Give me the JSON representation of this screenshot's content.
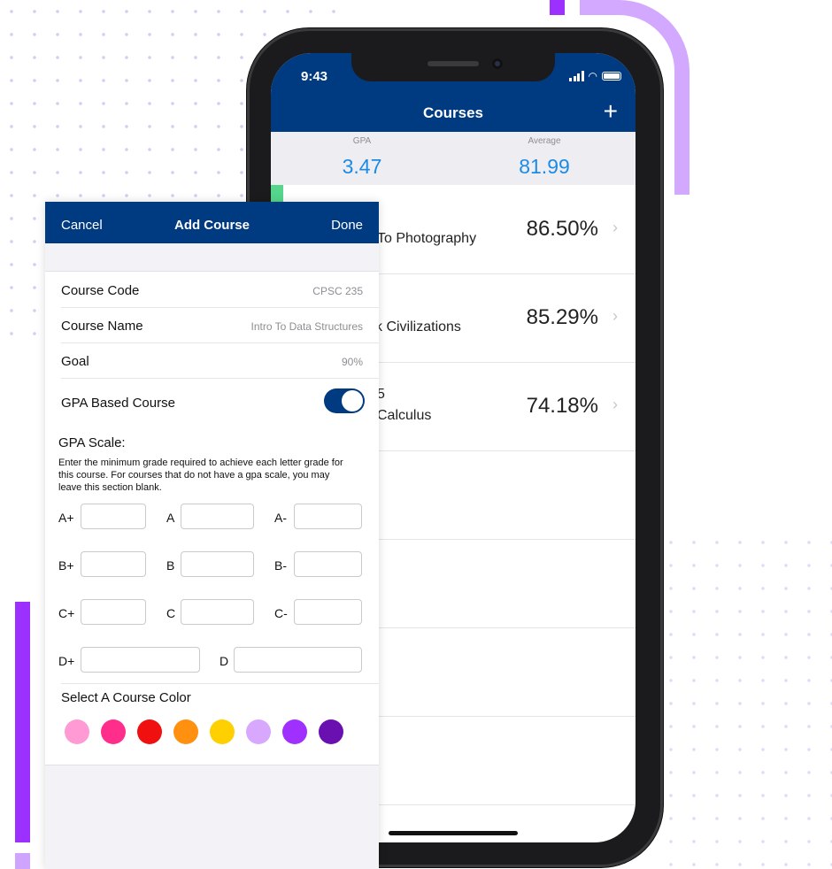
{
  "courses_screen": {
    "status_time": "9:43",
    "title": "Courses",
    "add_label": "+",
    "gpa_label": "GPA",
    "gpa_value": "3.47",
    "average_label": "Average",
    "average_value": "81.99",
    "courses": [
      {
        "code": "",
        "name": "To Photography",
        "percent": "86.50%",
        "color": "#55d68c"
      },
      {
        "code": "",
        "name": "k Civilizations",
        "percent": "85.29%"
      },
      {
        "code": "5",
        "name": "Calculus",
        "percent": "74.18%"
      }
    ],
    "chevron": "›"
  },
  "add_course": {
    "cancel": "Cancel",
    "title": "Add Course",
    "done": "Done",
    "fields": [
      {
        "label": "Course Code",
        "value": "CPSC 235"
      },
      {
        "label": "Course Name",
        "value": "Intro To Data Structures"
      },
      {
        "label": "Goal",
        "value": "90%"
      }
    ],
    "gpa_toggle_label": "GPA Based Course",
    "gpa_toggle_on": true,
    "gpa_scale_title": "GPA Scale:",
    "gpa_scale_desc": "Enter the minimum grade required to achieve each letter grade for this course. For courses that do not have a gpa scale, you may leave this section blank.",
    "grades": [
      "A+",
      "A",
      "A-",
      "B+",
      "B",
      "B-",
      "C+",
      "C",
      "C-",
      "D+",
      "D"
    ],
    "color_title": "Select A Course Color",
    "colors": [
      "#ff9ad5",
      "#ff2e8a",
      "#f01010",
      "#ff9010",
      "#ffd000",
      "#d8a8ff",
      "#a030ff",
      "#6a10b0"
    ]
  }
}
